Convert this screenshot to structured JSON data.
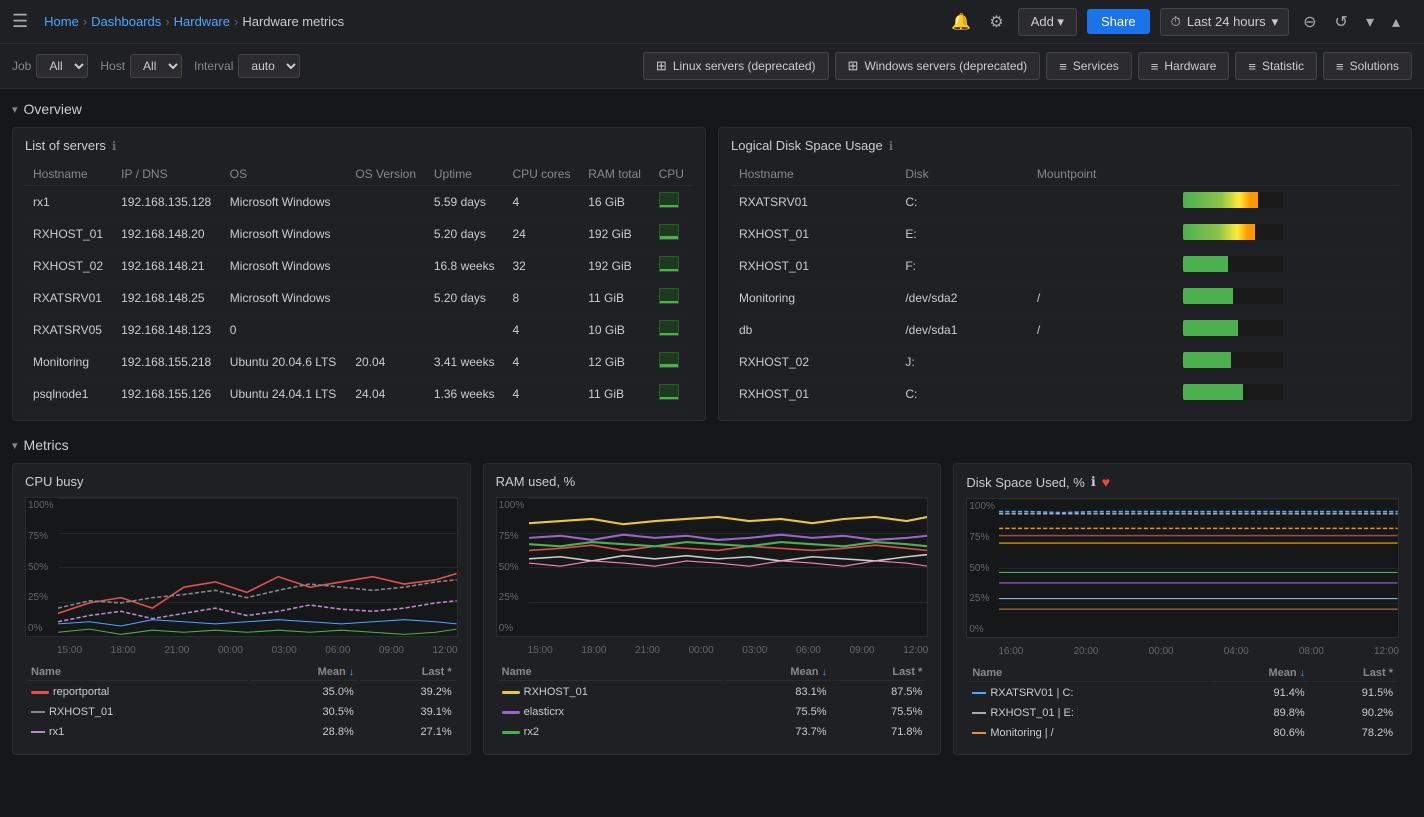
{
  "topbar": {
    "menu_icon": "☰",
    "breadcrumb": [
      {
        "label": "Home",
        "type": "link"
      },
      {
        "label": "Dashboards",
        "type": "link"
      },
      {
        "label": "Hardware",
        "type": "link"
      },
      {
        "label": "Hardware metrics",
        "type": "current"
      }
    ],
    "add_label": "Add ▾",
    "share_label": "Share",
    "time_icon": "⏱",
    "time_label": "Last 24 hours",
    "time_arrow": "▾",
    "zoom_in_icon": "⊖",
    "zoom_out_icon": "↺",
    "more_icon": "▾",
    "collapse_icon": "▴"
  },
  "filterbar": {
    "job_label": "Job",
    "job_value": "All",
    "host_label": "Host",
    "host_value": "All",
    "interval_label": "Interval",
    "interval_value": "auto",
    "tabs": [
      {
        "label": "Linux servers (deprecated)",
        "icon": "⊞"
      },
      {
        "label": "Windows servers (deprecated)",
        "icon": "⊞"
      },
      {
        "label": "Services",
        "icon": "≡"
      },
      {
        "label": "Hardware",
        "icon": "≡"
      },
      {
        "label": "Statistic",
        "icon": "≡"
      },
      {
        "label": "Solutions",
        "icon": "≡"
      }
    ]
  },
  "overview": {
    "title": "Overview",
    "servers_panel": {
      "title": "List of servers",
      "columns": [
        "Hostname",
        "IP / DNS",
        "OS",
        "OS Version",
        "Uptime",
        "CPU cores",
        "RAM total",
        "CPU"
      ],
      "rows": [
        {
          "hostname": "rx1",
          "ip": "192.168.135.128",
          "os": "Microsoft Windows",
          "os_version": "",
          "uptime": "5.59 days",
          "cpu_cores": "4",
          "ram_total": "16 GiB",
          "cpu_pct": 15
        },
        {
          "hostname": "RXHOST_01",
          "ip": "192.168.148.20",
          "os": "Microsoft Windows",
          "os_version": "",
          "uptime": "5.20 days",
          "cpu_cores": "24",
          "ram_total": "192 GiB",
          "cpu_pct": 20
        },
        {
          "hostname": "RXHOST_02",
          "ip": "192.168.148.21",
          "os": "Microsoft Windows",
          "os_version": "",
          "uptime": "16.8 weeks",
          "cpu_cores": "32",
          "ram_total": "192 GiB",
          "cpu_pct": 10
        },
        {
          "hostname": "RXATSRV01",
          "ip": "192.168.148.25",
          "os": "Microsoft Windows",
          "os_version": "",
          "uptime": "5.20 days",
          "cpu_cores": "8",
          "ram_total": "11 GiB",
          "cpu_pct": 12
        },
        {
          "hostname": "RXATSRV05",
          "ip": "192.168.148.123",
          "os": "0",
          "os_version": "",
          "uptime": "",
          "cpu_cores": "4",
          "ram_total": "10 GiB",
          "cpu_pct": 8
        },
        {
          "hostname": "Monitoring",
          "ip": "192.168.155.218",
          "os": "Ubuntu 20.04.6 LTS",
          "os_version": "20.04",
          "uptime": "3.41 weeks",
          "cpu_cores": "4",
          "ram_total": "12 GiB",
          "cpu_pct": 18
        },
        {
          "hostname": "psqlnode1",
          "ip": "192.168.155.126",
          "os": "Ubuntu 24.04.1 LTS",
          "os_version": "24.04",
          "uptime": "1.36 weeks",
          "cpu_cores": "4",
          "ram_total": "11 GiB",
          "cpu_pct": 5
        }
      ]
    },
    "disk_panel": {
      "title": "Logical Disk Space Usage",
      "columns": [
        "Hostname",
        "Disk",
        "Mountpoint",
        ""
      ],
      "rows": [
        {
          "hostname": "RXATSRV01",
          "disk": "C:",
          "mountpoint": "",
          "fill_pct": 75,
          "color": "gradient1"
        },
        {
          "hostname": "RXHOST_01",
          "disk": "E:",
          "mountpoint": "",
          "fill_pct": 72,
          "color": "gradient1"
        },
        {
          "hostname": "RXHOST_01",
          "disk": "F:",
          "mountpoint": "",
          "fill_pct": 45,
          "color": "green"
        },
        {
          "hostname": "Monitoring",
          "disk": "/dev/sda2",
          "mountpoint": "/",
          "fill_pct": 50,
          "color": "green"
        },
        {
          "hostname": "db",
          "disk": "/dev/sda1",
          "mountpoint": "/",
          "fill_pct": 55,
          "color": "green"
        },
        {
          "hostname": "RXHOST_02",
          "disk": "J:",
          "mountpoint": "",
          "fill_pct": 48,
          "color": "green"
        },
        {
          "hostname": "RXHOST_01",
          "disk": "C:",
          "mountpoint": "",
          "fill_pct": 60,
          "color": "green"
        }
      ]
    }
  },
  "metrics": {
    "title": "Metrics",
    "cpu_chart": {
      "title": "CPU busy",
      "y_labels": [
        "100%",
        "75%",
        "50%",
        "25%",
        "0%"
      ],
      "x_labels": [
        "15:00",
        "18:00",
        "21:00",
        "00:00",
        "03:00",
        "06:00",
        "09:00",
        "12:00"
      ],
      "legend_cols": [
        "Name",
        "Mean ↓",
        "Last *"
      ],
      "legend": [
        {
          "name": "reportportal",
          "color": "#e05050",
          "dash": false,
          "mean": "35.0%",
          "last": "39.2%"
        },
        {
          "name": "RXHOST_01",
          "color": "#888888",
          "dash": true,
          "mean": "30.5%",
          "last": "39.1%"
        },
        {
          "name": "rx1",
          "color": "#bb88cc",
          "dash": true,
          "mean": "28.8%",
          "last": "27.1%"
        }
      ]
    },
    "ram_chart": {
      "title": "RAM used, %",
      "y_labels": [
        "100%",
        "75%",
        "50%",
        "25%",
        "0%"
      ],
      "x_labels": [
        "15:00",
        "18:00",
        "21:00",
        "00:00",
        "03:00",
        "06:00",
        "09:00",
        "12:00"
      ],
      "legend_cols": [
        "Name",
        "Mean ↓",
        "Last *"
      ],
      "legend": [
        {
          "name": "RXHOST_01",
          "color": "#e8c840",
          "dash": false,
          "mean": "83.1%",
          "last": "87.5%"
        },
        {
          "name": "elasticrx",
          "color": "#9966cc",
          "dash": false,
          "mean": "75.5%",
          "last": "75.5%"
        },
        {
          "name": "rx2",
          "color": "#4caf50",
          "dash": false,
          "mean": "73.7%",
          "last": "71.8%"
        }
      ]
    },
    "disk_chart": {
      "title": "Disk Space Used, %",
      "has_heart": true,
      "y_labels": [
        "100%",
        "75%",
        "50%",
        "25%",
        "0%"
      ],
      "x_labels": [
        "16:00",
        "20:00",
        "00:00",
        "04:00",
        "08:00",
        "12:00"
      ],
      "legend_cols": [
        "Name",
        "Mean ↓",
        "Last *"
      ],
      "legend": [
        {
          "name": "RXATSRV01 | C:",
          "color": "#4da6ff",
          "dash": true,
          "mean": "91.4%",
          "last": "91.5%"
        },
        {
          "name": "RXHOST_01 | E:",
          "color": "#aaaaaa",
          "dash": true,
          "mean": "89.8%",
          "last": "90.2%"
        },
        {
          "name": "Monitoring | /",
          "color": "#e89040",
          "dash": true,
          "mean": "80.6%",
          "last": "78.2%"
        }
      ]
    }
  }
}
